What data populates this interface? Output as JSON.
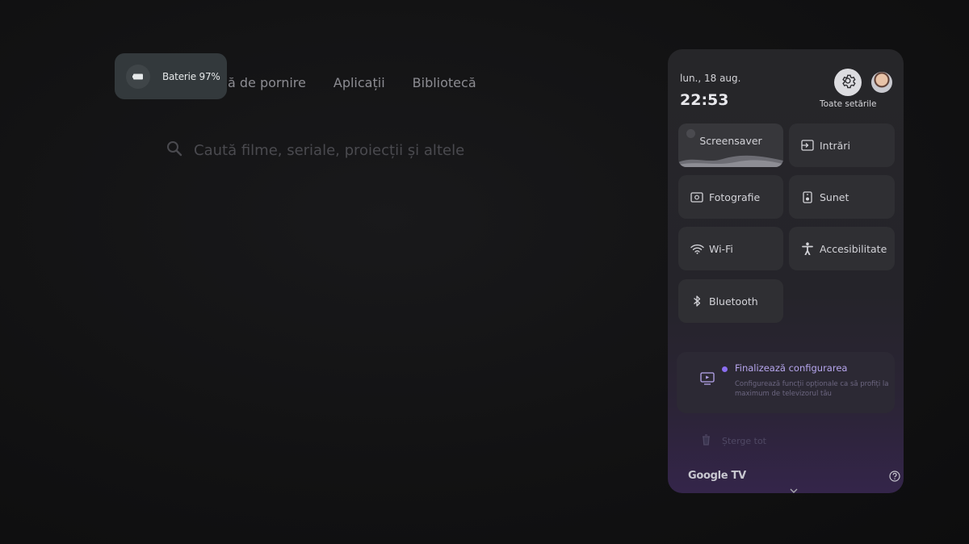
{
  "battery": {
    "label": "Baterie 97%"
  },
  "nav": {
    "items": [
      {
        "label": "ă de pornire"
      },
      {
        "label": "Aplicații"
      },
      {
        "label": "Bibliotecă"
      }
    ]
  },
  "search": {
    "placeholder": "Caută filme, seriale, proiecții și altele"
  },
  "panel": {
    "date": "lun., 18 aug.",
    "time": "22:53",
    "all_settings_label": "Toate setările",
    "tiles": {
      "screensaver": "Screensaver",
      "inputs": "Intrări",
      "photo": "Fotografie",
      "sound": "Sunet",
      "wifi": "Wi-Fi",
      "accessibility": "Accesibilitate",
      "bluetooth": "Bluetooth"
    },
    "config_card": {
      "title": "Finalizează configurarea",
      "description": "Configurează funcții opționale ca să profiți la maximum de televizorul tău"
    },
    "clear_all": "Șterge tot",
    "brand": "Google TV"
  },
  "colors": {
    "accent": "#8b6ef0",
    "panel_bg": "#262629",
    "tile_bg": "#2f2f33"
  }
}
